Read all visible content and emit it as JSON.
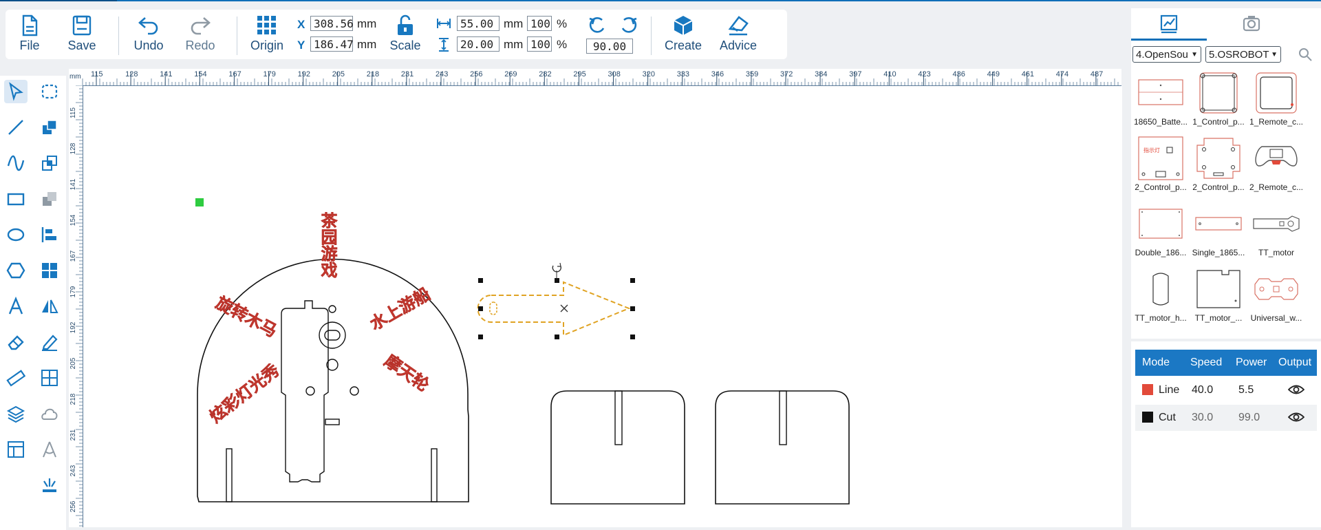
{
  "toolbar": {
    "file": "File",
    "save": "Save",
    "undo": "Undo",
    "redo": "Redo",
    "origin": "Origin",
    "scale": "Scale",
    "create": "Create",
    "advice": "Advice"
  },
  "position": {
    "x_label": "X",
    "x_value": "308.56",
    "y_label": "Y",
    "y_value": "186.47",
    "unit": "mm"
  },
  "size": {
    "width_value": "55.00",
    "height_value": "20.00",
    "unit": "mm",
    "width_pct": "100",
    "height_pct": "100",
    "pct_sign": "%"
  },
  "rotation": {
    "value": "90.00"
  },
  "ruler": {
    "unit": "mm",
    "top_ticks": [
      "115",
      "128",
      "141",
      "154",
      "167",
      "179",
      "192",
      "205",
      "218",
      "231",
      "243",
      "256",
      "269",
      "282",
      "295",
      "308",
      "320",
      "333",
      "346",
      "359",
      "372",
      "384",
      "397",
      "410",
      "423",
      "436",
      "449",
      "461",
      "474",
      "487"
    ],
    "left_ticks": [
      "115",
      "128",
      "141",
      "154",
      "167",
      "179",
      "192",
      "205",
      "218",
      "231",
      "243",
      "256"
    ]
  },
  "canvas": {
    "design_texts": [
      "旋转木马",
      "茶园游戏",
      "水上游船",
      "炫彩灯光秀",
      "摩天轮"
    ],
    "accent_red": "#e24a3a",
    "selection_color": "#e0a323"
  },
  "right_panel": {
    "tabs": [
      "chart-icon",
      "camera-icon"
    ],
    "dropdown1": "4.OpenSou",
    "dropdown2": "5.OSROBOT",
    "items": [
      {
        "label": "18650_Batte..."
      },
      {
        "label": "1_Control_p..."
      },
      {
        "label": "1_Remote_c..."
      },
      {
        "label": "2_Control_p..."
      },
      {
        "label": "2_Control_p..."
      },
      {
        "label": "2_Remote_c..."
      },
      {
        "label": "Double_186..."
      },
      {
        "label": "Single_1865..."
      },
      {
        "label": "TT_motor"
      },
      {
        "label": "TT_motor_h..."
      },
      {
        "label": "TT_motor_..."
      },
      {
        "label": "Universal_w..."
      }
    ],
    "thumb_badge": "指示灯"
  },
  "layers": {
    "headers": {
      "mode": "Mode",
      "speed": "Speed",
      "power": "Power",
      "output": "Output"
    },
    "rows": [
      {
        "mode": "Line",
        "speed": "40.0",
        "power": "5.5",
        "color": "#e24a3a"
      },
      {
        "mode": "Cut",
        "speed": "30.0",
        "power": "99.0",
        "color": "#111111"
      }
    ]
  }
}
